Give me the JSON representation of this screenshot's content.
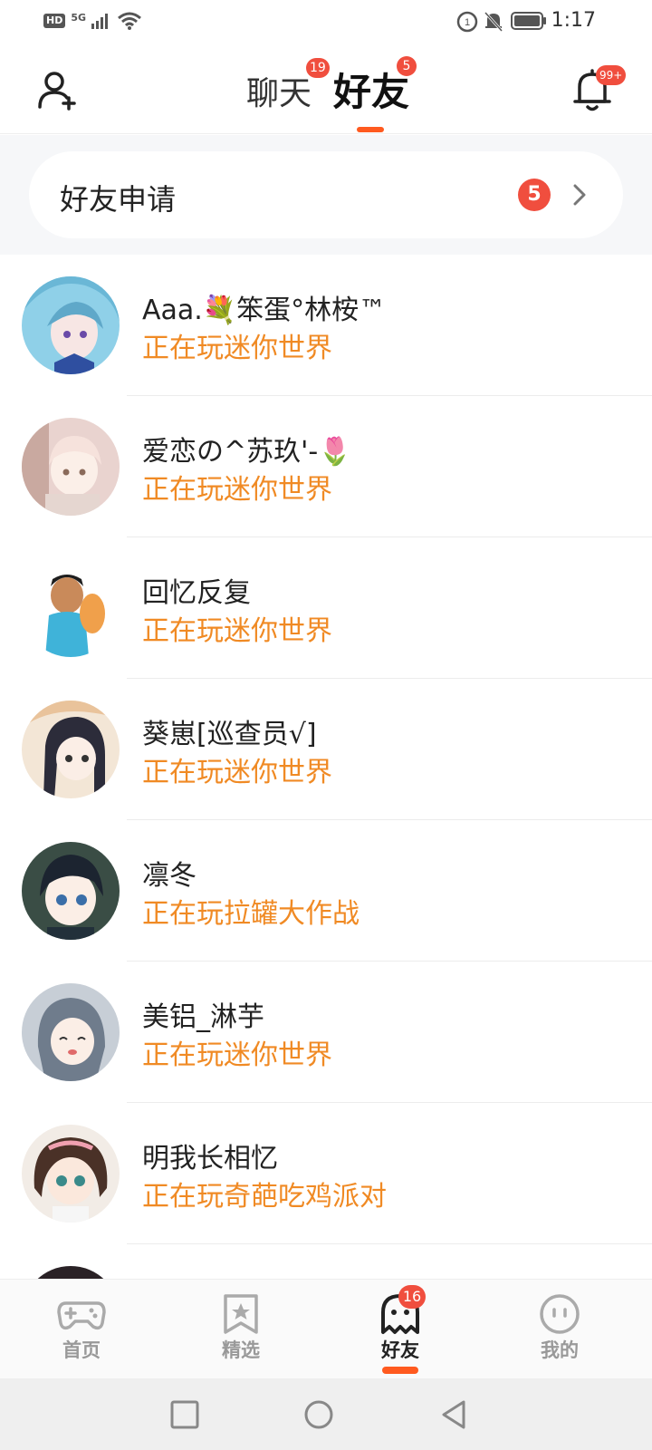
{
  "status_bar": {
    "hd": "HD",
    "network": "5G",
    "time": "1:17"
  },
  "header": {
    "tabs": [
      {
        "label": "聊天",
        "badge": "19"
      },
      {
        "label": "好友",
        "badge": "5",
        "active": true
      }
    ],
    "bell_badge": "99+"
  },
  "friend_request": {
    "label": "好友申请",
    "count": "5"
  },
  "friends": [
    {
      "name": "Aaa.💐笨蛋°林桉™",
      "status": "正在玩迷你世界",
      "avatar_color": "#8fd0e8"
    },
    {
      "name": "爱恋の^苏玖'-🌷",
      "status": "正在玩迷你世界",
      "avatar_color": "#f1d8d0"
    },
    {
      "name": "回忆反复",
      "status": "正在玩迷你世界",
      "avatar_color": "#3fb3d9"
    },
    {
      "name": "葵崽[巡查员√]",
      "status": "正在玩迷你世界",
      "avatar_color": "#e9c39b"
    },
    {
      "name": "凛冬",
      "status": "正在玩拉罐大作战",
      "avatar_color": "#3a4d45"
    },
    {
      "name": "美铝_淋芋",
      "status": "正在玩迷你世界",
      "avatar_color": "#9aa7b5"
    },
    {
      "name": "明我长相忆",
      "status": "正在玩奇葩吃鸡派对",
      "avatar_color": "#5a3b2e"
    }
  ],
  "bottom_nav": [
    {
      "label": "首页",
      "icon": "gamepad-icon"
    },
    {
      "label": "精选",
      "icon": "star-bookmark-icon"
    },
    {
      "label": "好友",
      "icon": "ghost-icon",
      "badge": "16",
      "active": true
    },
    {
      "label": "我的",
      "icon": "face-icon"
    }
  ],
  "colors": {
    "accent": "#ff5a1f",
    "badge": "#f04e3e",
    "status_text": "#f08a24"
  }
}
